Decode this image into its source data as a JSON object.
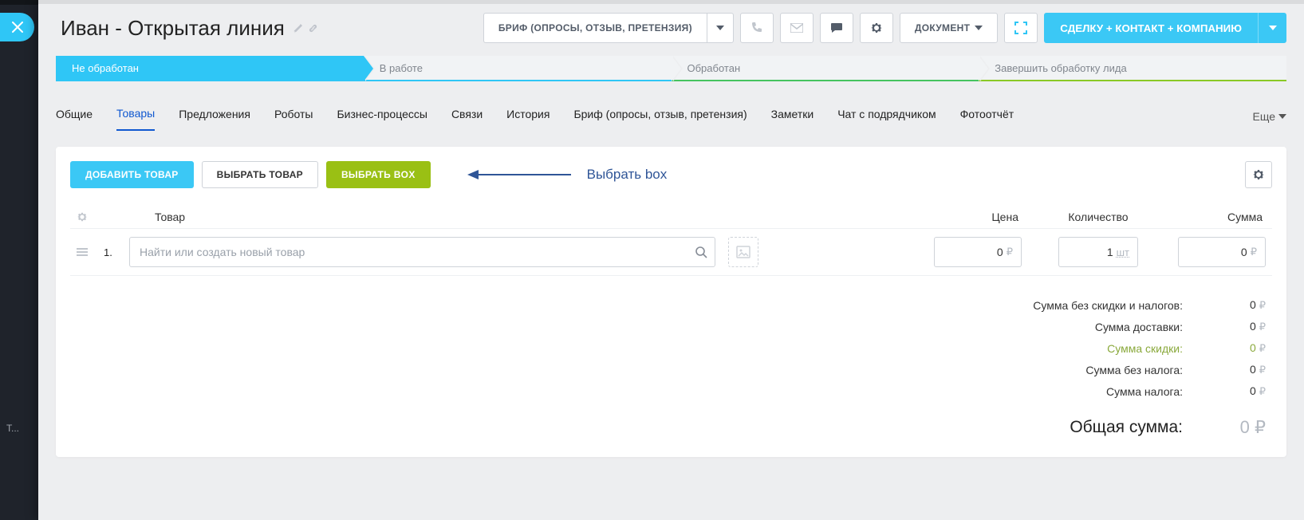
{
  "sidebar": {
    "letter_indicator": "Т..."
  },
  "header": {
    "title": "Иван - Открытая линия",
    "brief_button": "БРИФ (ОПРОСЫ, ОТЗЫВ, ПРЕТЕНЗИЯ)",
    "document_button": "ДОКУМЕНТ",
    "primary_button": "СДЕЛКУ + КОНТАКТ + КОМПАНИЮ"
  },
  "stages": [
    "Не обработан",
    "В работе",
    "Обработан",
    "Завершить обработку лида"
  ],
  "tabs": {
    "items": [
      "Общие",
      "Товары",
      "Предложения",
      "Роботы",
      "Бизнес-процессы",
      "Связи",
      "История",
      "Бриф (опросы, отзыв, претензия)",
      "Заметки",
      "Чат с подрядчиком",
      "Фотоотчёт"
    ],
    "more": "Еще"
  },
  "actions": {
    "add_product": "ДОБАВИТЬ ТОВАР",
    "select_product": "ВЫБРАТЬ ТОВАР",
    "select_box": "ВЫБРАТЬ BOX",
    "annotation": "Выбрать box"
  },
  "table": {
    "columns": {
      "product": "Товар",
      "price": "Цена",
      "qty": "Количество",
      "sum": "Сумма"
    },
    "row": {
      "index": "1.",
      "placeholder": "Найти или создать новый товар",
      "price": "0",
      "qty": "1",
      "sum": "0",
      "currency": "₽",
      "unit": "шт"
    }
  },
  "totals": {
    "lines": [
      {
        "label": "Сумма без скидки и налогов:",
        "value": "0"
      },
      {
        "label": "Сумма доставки:",
        "value": "0"
      },
      {
        "label": "Сумма скидки:",
        "value": "0"
      },
      {
        "label": "Сумма без налога:",
        "value": "0"
      },
      {
        "label": "Сумма налога:",
        "value": "0"
      }
    ],
    "grand_label": "Общая сумма:",
    "grand_value": "0",
    "currency": "₽"
  }
}
